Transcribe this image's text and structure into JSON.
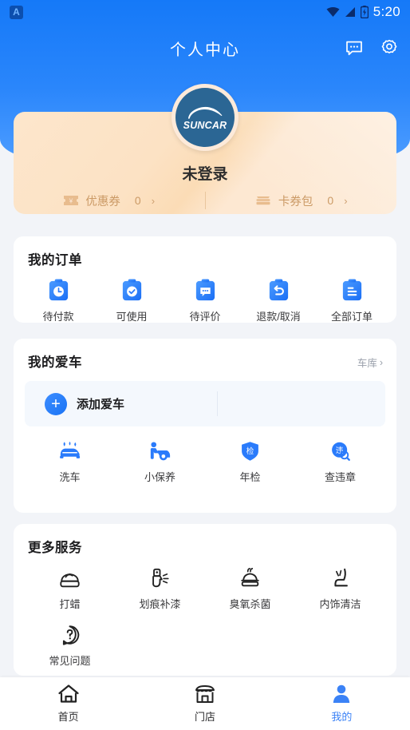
{
  "statusbar": {
    "app_icon": "app-letter-icon",
    "app_letter": "A",
    "wifi_icon": "wifi-icon",
    "signal_icon": "signal-icon",
    "battery_icon": "battery-charging-icon",
    "time": "5:20"
  },
  "header": {
    "title": "个人中心",
    "message_icon": "message-bubble-icon",
    "settings_icon": "gear-icon",
    "bg_color": "#1579f8"
  },
  "profile": {
    "avatar_icon": "suncar-logo-avatar",
    "avatar_brand": "SUNCAR",
    "avatar_bg": "#2b6694",
    "username": "未登录",
    "card_accent": "#cb9a66",
    "wallet": [
      {
        "icon": "coupon-ticket-icon",
        "label": "优惠券",
        "count": "0",
        "chevron": "›"
      },
      {
        "icon": "card-package-icon",
        "label": "卡券包",
        "count": "0",
        "chevron": "›"
      }
    ]
  },
  "orders": {
    "title": "我的订单",
    "items": [
      {
        "icon": "clipboard-clock-icon",
        "label": "待付款"
      },
      {
        "icon": "clipboard-check-icon",
        "label": "可使用"
      },
      {
        "icon": "clipboard-comment-icon",
        "label": "待评价"
      },
      {
        "icon": "clipboard-refund-icon",
        "label": "退款/取消"
      },
      {
        "icon": "clipboard-list-icon",
        "label": "全部订单"
      }
    ]
  },
  "mycar": {
    "title": "我的爱车",
    "link_label": "车库",
    "link_chevron": "›",
    "add_icon": "plus-circle-icon",
    "add_label": "添加爱车",
    "services": [
      {
        "icon": "car-wash-icon",
        "label": "洗车"
      },
      {
        "icon": "maintenance-icon",
        "label": "小保养"
      },
      {
        "icon": "shield-inspection-icon",
        "label": "年检",
        "badge": "检"
      },
      {
        "icon": "violation-search-icon",
        "label": "查违章",
        "badge": "违"
      }
    ]
  },
  "more_services": {
    "title": "更多服务",
    "items": [
      {
        "icon": "wax-icon",
        "label": "打蜡"
      },
      {
        "icon": "spray-paint-icon",
        "label": "划痕补漆"
      },
      {
        "icon": "ozone-icon",
        "label": "臭氧杀菌"
      },
      {
        "icon": "car-seat-icon",
        "label": "内饰清洁"
      },
      {
        "icon": "question-icon",
        "label": "常见问题"
      }
    ]
  },
  "bottom_nav": {
    "active_color": "#3b82f6",
    "items": [
      {
        "icon": "home-icon",
        "label": "首页",
        "active": false
      },
      {
        "icon": "store-icon",
        "label": "门店",
        "active": false
      },
      {
        "icon": "person-icon",
        "label": "我的",
        "active": true
      }
    ]
  }
}
